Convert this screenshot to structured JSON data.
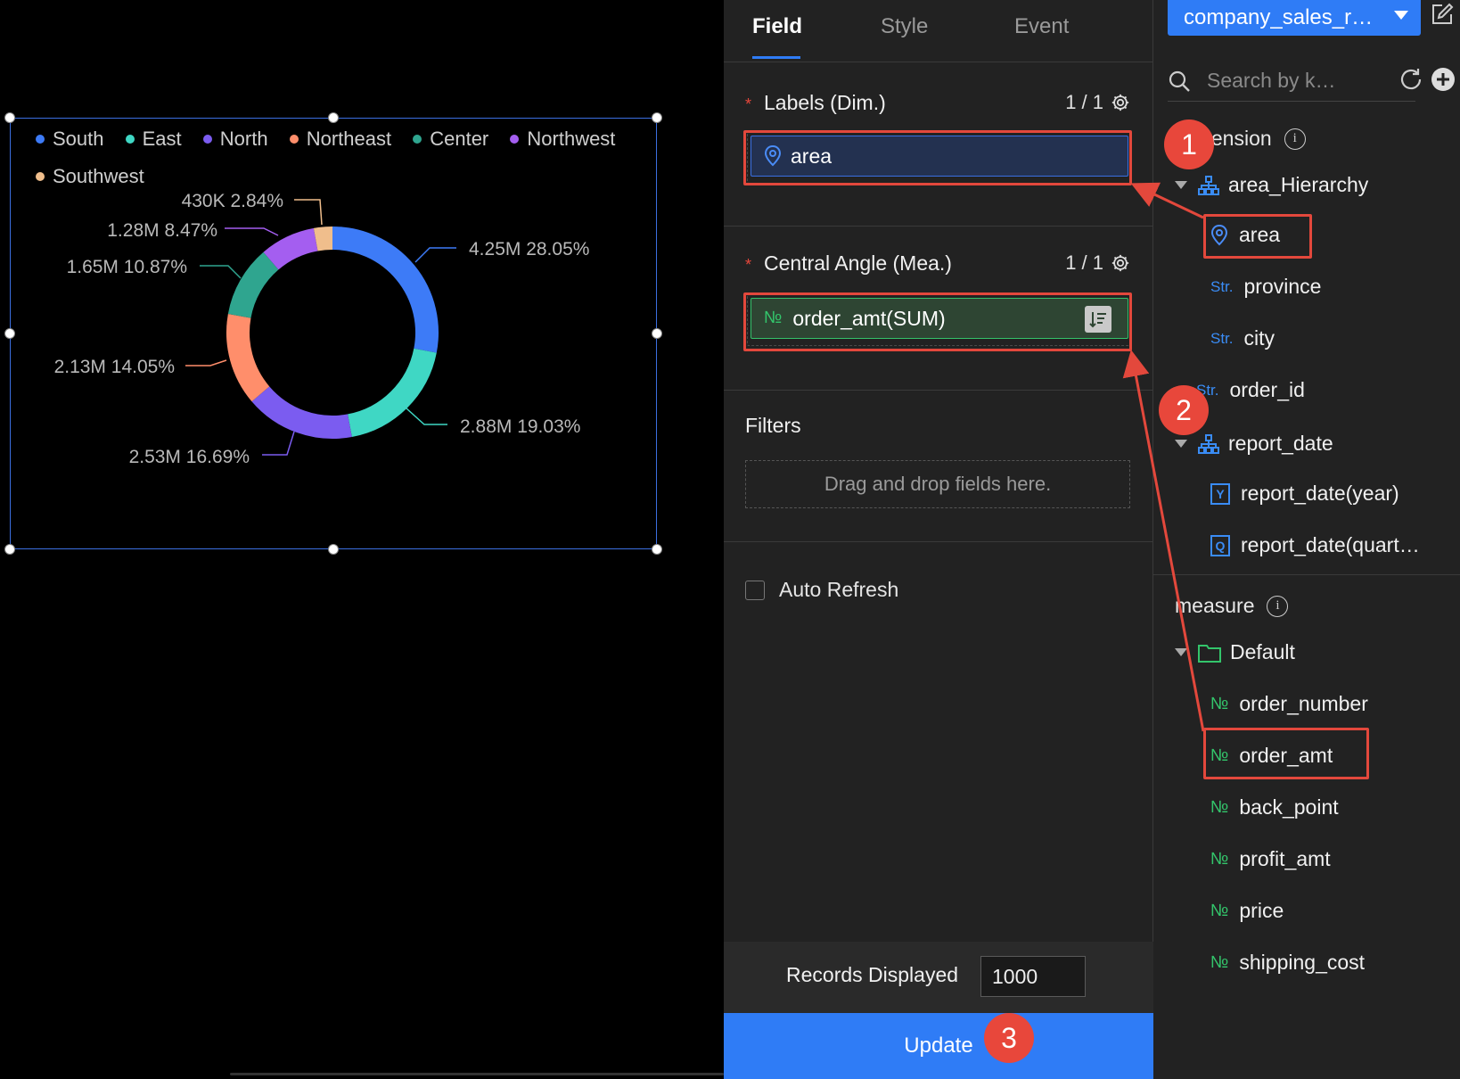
{
  "chart": {
    "legend": [
      {
        "name": "South",
        "color": "#3d7bf7"
      },
      {
        "name": "East",
        "color": "#3fd7c4"
      },
      {
        "name": "North",
        "color": "#7b5cf0"
      },
      {
        "name": "Northeast",
        "color": "#ff8e6b"
      },
      {
        "name": "Center",
        "color": "#2fa58f"
      },
      {
        "name": "Northwest",
        "color": "#a45ef0"
      },
      {
        "name": "Southwest",
        "color": "#f0be8c"
      }
    ],
    "slice_labels": {
      "south": "4.25M 28.05%",
      "east": "2.88M 19.03%",
      "north": "2.53M 16.69%",
      "northeast": "2.13M 14.05%",
      "center": "1.65M 10.87%",
      "northwest": "1.28M 8.47%",
      "southwest": "430K 2.84%"
    }
  },
  "chart_data": {
    "type": "pie",
    "categories": [
      "South",
      "East",
      "North",
      "Northeast",
      "Center",
      "Northwest",
      "Southwest"
    ],
    "values": [
      4250000,
      2880000,
      2530000,
      2130000,
      1650000,
      1280000,
      430000
    ],
    "percentages": [
      28.05,
      19.03,
      16.69,
      14.05,
      10.87,
      8.47,
      2.84
    ],
    "colors": [
      "#3d7bf7",
      "#3fd7c4",
      "#7b5cf0",
      "#ff8e6b",
      "#2fa58f",
      "#a45ef0",
      "#f0be8c"
    ],
    "legend_position": "top-left",
    "donut": true
  },
  "config": {
    "tabs": [
      "Field",
      "Style",
      "Event"
    ],
    "labels_section": {
      "title": "Labels (Dim.)",
      "counter": "1 / 1",
      "field": "area"
    },
    "angle_section": {
      "title": "Central Angle (Mea.)",
      "counter": "1 / 1",
      "field": "order_amt(SUM)"
    },
    "filters": {
      "title": "Filters",
      "placeholder": "Drag and drop fields here."
    },
    "auto_refresh": "Auto Refresh",
    "records": {
      "label": "Records Displayed",
      "value": "1000"
    },
    "update": "Update"
  },
  "dataset": {
    "name": "company_sales_r…",
    "search_placeholder": "Search by k…",
    "dimension_header": "Dimension",
    "measure_header": "measure",
    "dimension_items": {
      "hierarchy": "area_Hierarchy",
      "area": "area",
      "province": "province",
      "city": "city",
      "order_id": "order_id",
      "report_date": "report_date",
      "report_date_year": "report_date(year)",
      "report_date_quarter": "report_date(quart…"
    },
    "measure_folder": "Default",
    "measure_items": [
      "order_number",
      "order_amt",
      "back_point",
      "profit_amt",
      "price",
      "shipping_cost"
    ],
    "type_str": "Str.",
    "type_num": "№",
    "type_year": "Y",
    "type_quarter": "Q"
  },
  "annotations": {
    "step1": "1",
    "step2": "2",
    "step3": "3"
  },
  "colors": {
    "accent": "#2f7cf6",
    "highlight": "#e3483c"
  }
}
